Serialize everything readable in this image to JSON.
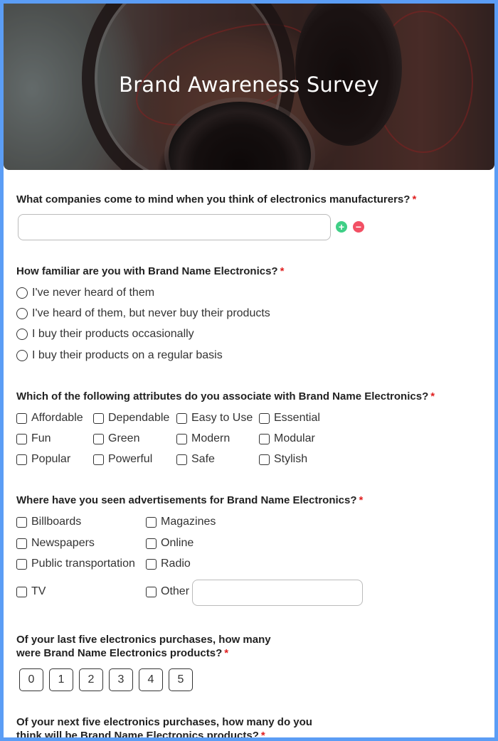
{
  "survey": {
    "title": "Brand Awareness Survey",
    "banner_image": "headphones-photo",
    "required_marker": "*"
  },
  "questions": [
    {
      "id": "q1",
      "type": "text-multi",
      "title": "What companies come to mind when you think of electronics manufacturers?",
      "required": true,
      "value": "",
      "add_icon": "plus-circle-icon",
      "remove_icon": "minus-circle-icon",
      "colors": {
        "add": "#3fcf86",
        "remove": "#f25064"
      }
    },
    {
      "id": "q2",
      "type": "radio",
      "title": "How familiar are you with Brand Name Electronics?",
      "required": true,
      "options": [
        "I've never heard of them",
        "I've heard of them, but never buy their products",
        "I buy their products occasionally",
        "I buy their products on a regular basis"
      ]
    },
    {
      "id": "q3",
      "type": "checkbox",
      "title": "Which of the following attributes do you associate with Brand Name Electronics?",
      "required": true,
      "options": [
        "Affordable",
        "Dependable",
        "Easy to Use",
        "Essential",
        "Fun",
        "Green",
        "Modern",
        "Modular",
        "Popular",
        "Powerful",
        "Safe",
        "Stylish"
      ]
    },
    {
      "id": "q4",
      "type": "checkbox",
      "title": "Where have you seen advertisements for Brand Name Electronics?",
      "required": true,
      "options": [
        "Billboards",
        "Magazines",
        "Newspapers",
        "Online",
        "Public transportation",
        "Radio",
        "TV",
        "Other"
      ],
      "other_value": ""
    },
    {
      "id": "q5",
      "type": "scale",
      "title_line1": "Of your last five electronics purchases, how many",
      "title_line2": "were Brand Name Electronics products?",
      "required": true,
      "options": [
        "0",
        "1",
        "2",
        "3",
        "4",
        "5"
      ]
    },
    {
      "id": "q6",
      "type": "scale",
      "title_line1": "Of your next five electronics purchases, how many do you",
      "title_line2": "think will be Brand Name Electronics products?",
      "required": true
    }
  ],
  "theme": {
    "border": "#5b9df5",
    "required": "#e02020"
  }
}
